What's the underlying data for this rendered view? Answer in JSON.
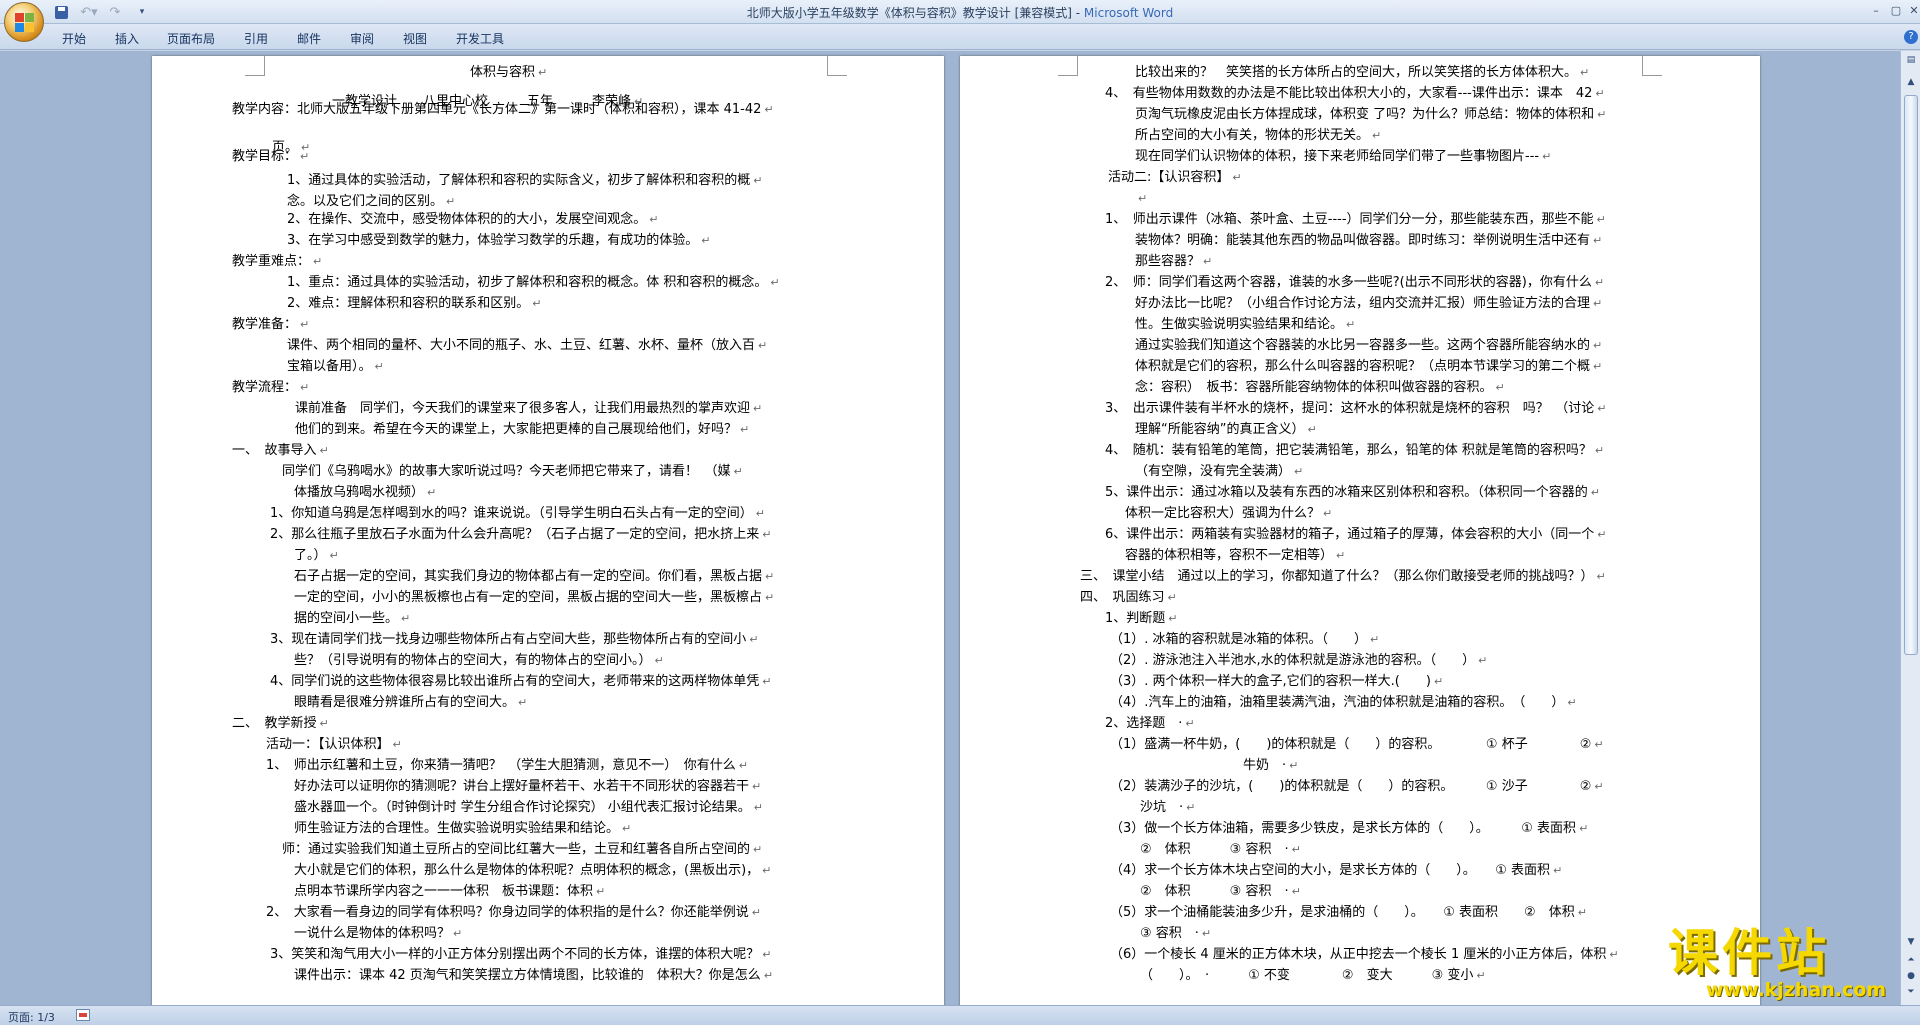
{
  "window": {
    "title": "北师大版小学五年级数学《体积与容积》教学设计 [兼容模式] - ",
    "app_name": "Microsoft Word",
    "minimize_label": "–",
    "maximize_label": "▢",
    "close_label": "✕"
  },
  "quick_access": {
    "save_icon": "save-icon",
    "undo_label": "↶▾",
    "redo_label": "↷",
    "more_label": "▾"
  },
  "ribbon": {
    "tabs": [
      {
        "label": "开始"
      },
      {
        "label": "插入"
      },
      {
        "label": "页面布局"
      },
      {
        "label": "引用"
      },
      {
        "label": "邮件"
      },
      {
        "label": "审阅"
      },
      {
        "label": "视图"
      },
      {
        "label": "开发工具"
      }
    ],
    "help_label": "?"
  },
  "document": {
    "paragraph_mark": "↵",
    "left_page": [
      "体积与容积",
      "一教学设计　　八里中心校　　　五年　　　李荣峰",
      "教学内容：北师大版五年级下册第四单元《长方体二》第一课时（体积和容积），课本 41-42",
      "页。",
      "教学目标：",
      "1、通过具体的实验活动，了解体积和容积的实际含义，初步了解体积和容积的概",
      "念。以及它们之间的区别。",
      "2、在操作、交流中，感受物体体积的的大小，发展空间观念。",
      "3、在学习中感受到数学的魅力，体验学习数学的乐趣，有成功的体验。",
      "教学重难点：",
      "1、重点：通过具体的实验活动，初步了解体积和容积的概念。体 积和容积的概念。",
      "2、难点：理解体积和容积的联系和区别。",
      "教学准备：",
      "课件、两个相同的量杯、大小不同的瓶子、水、土豆、红薯、水杯、量杯（放入百",
      "宝箱以备用）。",
      "教学流程：",
      "课前准备　同学们，今天我们的课堂来了很多客人，让我们用最热烈的掌声欢迎",
      "他们的到来。希望在今天的课堂上，大家能把更棒的自己展现给他们，好吗？",
      "一、　故事导入",
      "同学们《乌鸦喝水》的故事大家听说过吗？今天老师把它带来了，请看！　（媒",
      "体播放乌鸦喝水视频）",
      "1、你知道乌鸦是怎样喝到水的吗？谁来说说。（引导学生明白石头占有一定的空间）",
      "2、那么往瓶子里放石子水面为什么会升高呢？（石子占据了一定的空间，把水挤上来",
      "了。）",
      "石子占据一定的空间，其实我们身边的物体都占有一定的空间。你们看，黑板占据",
      "一定的空间，小小的黑板檫也占有一定的空间，黑板占据的空间大一些，黑板檫占",
      "据的空间小一些。",
      "3、现在请同学们找一找身边哪些物体所占有占空间大些，那些物体所占有的空间小",
      "些？（引导说明有的物体占的空间大，有的物体占的空间小。）",
      "4、同学们说的这些物体很容易比较出谁所占有的空间大，老师带来的这两样物体单凭",
      "眼睛看是很难分辨谁所占有的空间大。",
      "二、　教学新授",
      "活动一：【认识体积】",
      "1、　师出示红薯和土豆，你来猜一猜吧？　（学生大胆猜测，意见不一）　你有什么",
      "好办法可以证明你的猜测呢？讲台上摆好量杯若干、水若干不同形状的容器若干",
      "盛水器皿一个。（时钟倒计时 学生分组合作讨论探究） 小组代表汇报讨论结果。",
      "师生验证方法的合理性。生做实验说明实验结果和结论。",
      "师：通过实验我们知道土豆所占的空间比红薯大一些，土豆和红薯各自所占空间的",
      "大小就是它们的体积，那么什么是物体的体积呢？点明体积的概念，(黑板出示)，",
      "点明本节课所学内容之一一一体积　板书课题：体积",
      "2、　大家看一看身边的同学有体积吗？你身边同学的体积指的是什么？你还能举例说",
      "一说什么是物体的体积吗？",
      "3、笑笑和淘气用大小一样的小正方体分别摆出两个不同的长方体，谁摆的体积大呢？",
      "课件出示：课本 42 页淘气和笑笑摆立方体情境图，比较谁的　体积大？你是怎么"
    ],
    "right_page": [
      "比较出来的？　笑笑搭的长方体所占的空间大，所以笑笑搭的长方体体积大。",
      "4、　有些物体用数数的办法是不能比较出体积大小的，大家看---课件出示：课本　42",
      "页淘气玩橡皮泥由长方体捏成球，体积变 了吗？为什么？师总结：物体的体积和",
      "所占空间的大小有关，物体的形状无关。",
      "现在同学们认识物体的体积，接下来老师给同学们带了一些事物图片---",
      "活动二:【认识容积】",
      "",
      "1、　师出示课件（冰箱、茶叶盒、土豆----）同学们分一分，那些能装东西，那些不能",
      "装物体？明确：能装其他东西的物品叫做容器。即时练习：举例说明生活中还有",
      "那些容器？",
      "2、　师：同学们看这两个容器，谁装的水多一些呢?(出示不同形状的容器)，你有什么",
      "好办法比一比呢？（小组合作讨论方法，组内交流并汇报）师生验证方法的合理",
      "性。生做实验说明实验结果和结论。",
      "通过实验我们知道这个容器装的水比另一容器多一些。这两个容器所能容纳水的",
      "体积就是它们的容积，那么什么叫容器的容积呢？（点明本节课学习的第二个概",
      "念：容积）　板书：容器所能容纳物体的体积叫做容器的容积。",
      "3、　出示课件装有半杯水的烧杯，提问：这杯水的体积就是烧杯的容积　吗？　（讨论",
      "理解“所能容纳”的真正含义）",
      "4、　随机：装有铅笔的笔筒，把它装满铅笔，那么，铅笔的体 积就是笔筒的容积吗？",
      "（有空隙，没有完全装满）",
      "5、课件出示：通过冰箱以及装有东西的冰箱来区别体积和容积。（体积同一个容器的",
      "体积一定比容积大）强调为什么？",
      "6、课件出示：两箱装有实验器材的箱子，通过箱子的厚薄，体会容积的大小（同一个",
      "容器的体积相等，容积不一定相等）",
      "三、　课堂小结　通过以上的学习，你都知道了什么？（那么你们敢接受老师的挑战吗？）",
      "四、　巩固练习",
      "1、判断题",
      "（1）. 冰箱的容积就是冰箱的体积。（　　）",
      "（2）. 游泳池注入半池水,水的体积就是游泳池的容积。（　　）",
      "（3）. 两个体积一样大的盒子,它们的容积一样大.(　　)",
      "（4）.汽车上的油箱，油箱里装满汽油，汽油的体积就是油箱的容积。　（　　）",
      "2、选择题　·",
      "（1）盛满一杯牛奶，(　　)的体积就是（　　）的容积。　　　　① 杯子　　　　②",
      "牛奶　·",
      "（2）装满沙子的沙坑，(　　)的体积就是（　　）的容积。　　　① 沙子　　　　②",
      "沙坑　·",
      "（3）做一个长方体油箱，需要多少铁皮，是求长方体的（　　）。　　　① 表面积",
      "②　体积　　　③ 容积　·",
      "（4）求一个长方体木块占空间的大小，是求长方体的（　　）。　　① 表面积",
      "②　体积　　　③ 容积　·",
      "（5）求一个油桶能装油多少升，是求油桶的（　　）。　　① 表面积　　②　体积",
      "③ 容积　·",
      "（6）一个棱长 4 厘米的正方体木块，从正中挖去一个棱长 1 厘米的小正方体后，体积",
      "（　　）。　·　　　① 不变　　　　②　变大　　　③ 变小"
    ]
  },
  "statusbar": {
    "page_info": "页面: 1/3"
  },
  "watermark": {
    "brand": "课件站",
    "url": "www.kjzhan.com"
  }
}
